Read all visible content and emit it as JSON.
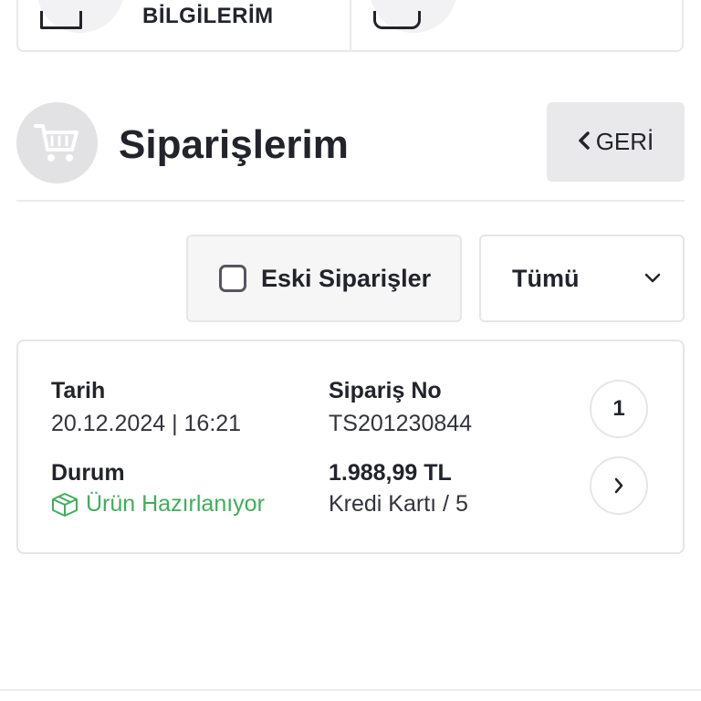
{
  "top_cards": {
    "left_label": "BİLGİLERİM"
  },
  "header": {
    "title": "Siparişlerim",
    "back_label": "GERİ"
  },
  "filters": {
    "old_orders_label": "Eski Siparişler",
    "old_orders_checked": false,
    "status_filter_value": "Tümü"
  },
  "order": {
    "date_label": "Tarih",
    "date_value": "20.12.2024 | 16:21",
    "order_no_label": "Sipariş No",
    "order_no_value": "TS201230844",
    "status_label": "Durum",
    "status_value": "Ürün Hazırlanıyor",
    "status_color": "#3fae5a",
    "total_value": "1.988,99 TL",
    "payment_value": "Kredi Kartı / 5",
    "item_count": "1"
  },
  "icons": {
    "header": "cart-icon",
    "status": "package-icon",
    "detail": "chevron-right-icon",
    "dropdown": "chevron-down-icon",
    "back": "chevron-left-icon"
  }
}
